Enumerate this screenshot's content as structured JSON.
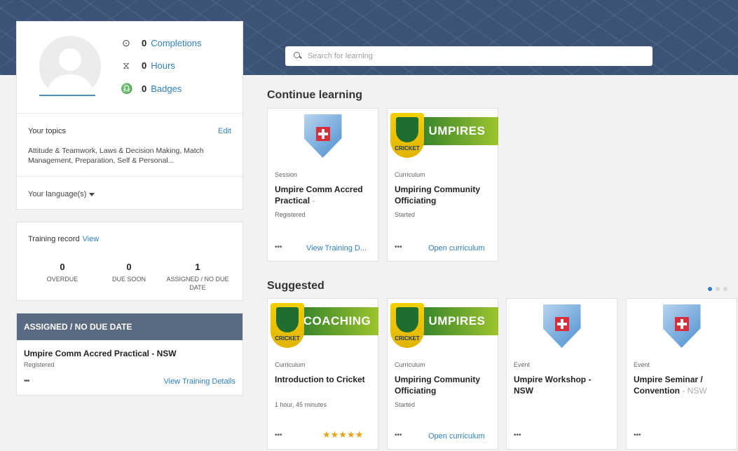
{
  "search": {
    "placeholder": "Search for learning"
  },
  "profile": {
    "completions": {
      "value": "0",
      "label": "Completions"
    },
    "hours": {
      "value": "0",
      "label": "Hours"
    },
    "badges": {
      "value": "0",
      "label": "Badges"
    },
    "topics_title": "Your topics",
    "edit_label": "Edit",
    "topics_text": "Attitude & Teamwork, Laws & Decision Making, Match Management, Preparation, Self & Personal...",
    "language_label": "Your language(s)"
  },
  "training_record": {
    "title": "Training record",
    "view_label": "View",
    "stats": [
      {
        "value": "0",
        "label": "OVERDUE"
      },
      {
        "value": "0",
        "label": "DUE SOON"
      },
      {
        "value": "1",
        "label": "ASSIGNED / NO DUE DATE"
      }
    ]
  },
  "assigned": {
    "header": "ASSIGNED / NO DUE DATE",
    "title": "Umpire Comm Accred Practical - NSW",
    "status": "Registered",
    "dots": "•••",
    "link": "View Training Details"
  },
  "continue_learning": {
    "title": "Continue learning",
    "cards": [
      {
        "type": "Session",
        "title": "Umpire Comm Accred Practical",
        "title_fade": " -",
        "meta": "Registered",
        "dots": "•••",
        "link": "View Training D..."
      },
      {
        "type": "Curriculum",
        "title": "Umpiring Community Officiating",
        "meta": "Started",
        "dots": "•••",
        "link": "Open curriculum",
        "banner": "UMPIRES",
        "badge_text": "CRICKET"
      }
    ]
  },
  "suggested": {
    "title": "Suggested",
    "cards": [
      {
        "type": "Curriculum",
        "title": "Introduction to Cricket",
        "meta": "1 hour, 45 minutes",
        "dots": "•••",
        "stars": "★★★★★",
        "banner": "COACHING",
        "badge_text": "CRICKET"
      },
      {
        "type": "Curriculum",
        "title": "Umpiring Community Officiating",
        "meta": "Started",
        "dots": "•••",
        "link": "Open curriculum",
        "banner": "UMPIRES",
        "badge_text": "CRICKET"
      },
      {
        "type": "Event",
        "title": "Umpire Workshop - NSW",
        "meta": "",
        "dots": "•••"
      },
      {
        "type": "Event",
        "title": "Umpire Seminar / Convention",
        "title_fade": " - NSW",
        "meta": "",
        "dots": "•••"
      }
    ]
  },
  "colors": {
    "accent": "#2d7fc1",
    "banner": "#3a5376",
    "assigned_header": "#5a6a80",
    "star": "#e8a317"
  }
}
